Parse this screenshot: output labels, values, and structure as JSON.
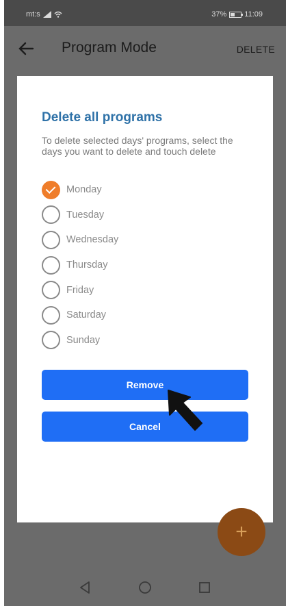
{
  "status_bar": {
    "carrier": "mt:s",
    "battery": "37%",
    "battery_level": 0.37,
    "time": "11:09"
  },
  "app_bar": {
    "title": "Program Mode",
    "action": "DELETE"
  },
  "dialog": {
    "title": "Delete all programs",
    "message": "To delete selected days' programs, select the days you want to delete and touch delete",
    "days": [
      {
        "label": "Monday",
        "checked": true
      },
      {
        "label": "Tuesday",
        "checked": false
      },
      {
        "label": "Wednesday",
        "checked": false
      },
      {
        "label": "Thursday",
        "checked": false
      },
      {
        "label": "Friday",
        "checked": false
      },
      {
        "label": "Saturday",
        "checked": false
      },
      {
        "label": "Sunday",
        "checked": false
      }
    ],
    "remove_label": "Remove",
    "cancel_label": "Cancel"
  },
  "fab": {
    "label": "+"
  },
  "colors": {
    "accent": "#1f6ef5",
    "title": "#2f72a8",
    "checked": "#ef7d2a"
  }
}
